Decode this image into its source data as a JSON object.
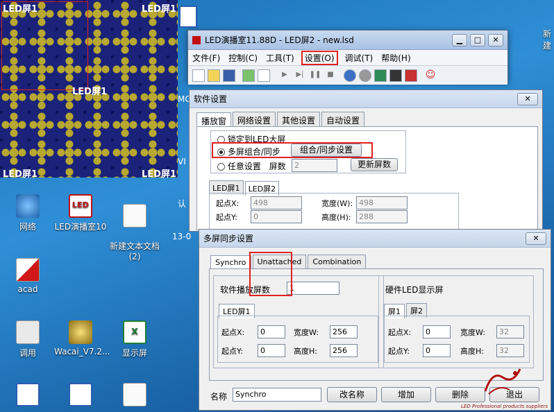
{
  "led_screen": {
    "label": "LED屏1"
  },
  "desktop": {
    "right_label": "新建",
    "icons": [
      {
        "label": "网络",
        "name": "network-icon"
      },
      {
        "label": "LED演播室10",
        "name": "led-studio-icon"
      },
      {
        "label": "新建文本文档\n(2)",
        "name": "text-doc-icon"
      },
      {
        "label": "acad",
        "name": "acad-icon"
      },
      {
        "label": "调用",
        "name": "shortcut-icon"
      },
      {
        "label": "Wacai_V7.2...",
        "name": "wacai-icon"
      },
      {
        "label": "显示屏",
        "name": "excel-icon"
      }
    ],
    "partial_labels": [
      "认",
      "13-0",
      "MG",
      "VI"
    ]
  },
  "main_window": {
    "title": "LED演播室11.88D - LED屏2 - new.lsd",
    "menu": [
      "文件(F)",
      "控制(C)",
      "工具(T)",
      "设置(O)",
      "调试(T)",
      "帮助(H)"
    ]
  },
  "settings_dialog": {
    "title": "软件设置",
    "tabs": [
      "播放窗",
      "网络设置",
      "其他设置",
      "自动设置"
    ],
    "radio_lock": "锁定到LED大屏",
    "radio_multi": "多屏组合/同步",
    "sync_button": "组合/同步设置",
    "radio_any": "任意设置",
    "screen_count_label": "屏数",
    "screen_count_value": "2",
    "update_button": "更新屏数",
    "screen_tabs": [
      "LED屏1",
      "LED屏2"
    ],
    "start_x_label": "起点X:",
    "start_x_value": "498",
    "start_y_label": "起点Y:",
    "start_y_value": "0",
    "width_label": "宽度(W):",
    "width_value": "498",
    "height_label": "高度(H):",
    "height_value": "288"
  },
  "sync_dialog": {
    "title": "多屏同步设置",
    "tabs": [
      "Synchro",
      "Unattached",
      "Combination"
    ],
    "sw_group_label": "软件播放屏数",
    "sw_count": "1",
    "sw_tab": "LED屏1",
    "sw_start_x_label": "起点X:",
    "sw_start_x": "0",
    "sw_width_label": "宽度W:",
    "sw_width": "256",
    "sw_start_y_label": "起点Y:",
    "sw_start_y": "0",
    "sw_height_label": "高度H:",
    "sw_height": "256",
    "hw_group_label": "硬件LED显示屏",
    "hw_tabs": [
      "屏1",
      "屏2"
    ],
    "hw_start_x_label": "起点X:",
    "hw_start_x": "0",
    "hw_width_label": "宽度W:",
    "hw_width": "32",
    "hw_start_y_label": "起点Y:",
    "hw_start_y": "0",
    "hw_height_label": "高度H:",
    "hw_height": "32",
    "name_label": "名称",
    "name_value": "Synchro",
    "rename_button": "改名称",
    "add_button": "增加",
    "delete_button": "删除",
    "exit_button": "退出"
  },
  "watermark": {
    "text": "LED Professional products suppliers"
  },
  "colors": {
    "highlight": "#e02020",
    "led_bg": "#1a2279",
    "led_pattern": "#b8a830"
  }
}
